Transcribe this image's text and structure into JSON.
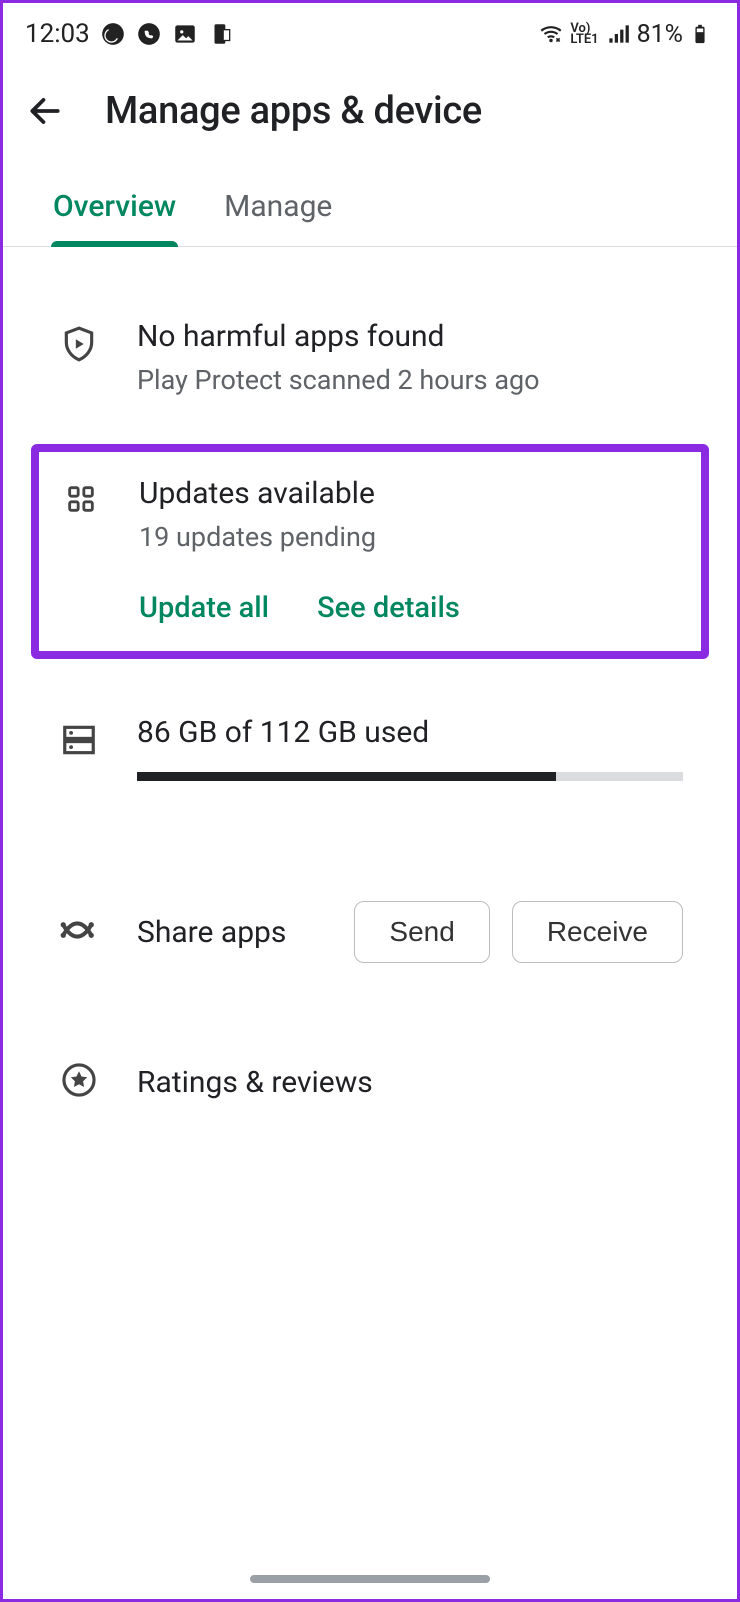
{
  "statusbar": {
    "time": "12:03",
    "lte_top": "Vo)",
    "lte_bottom": "LTE1",
    "battery_text": "81%"
  },
  "header": {
    "title": "Manage apps & device"
  },
  "tabs": {
    "overview": "Overview",
    "manage": "Manage"
  },
  "protect": {
    "title": "No harmful apps found",
    "subtitle": "Play Protect scanned 2 hours ago"
  },
  "updates": {
    "title": "Updates available",
    "subtitle": "19 updates pending",
    "update_all": "Update all",
    "see_details": "See details"
  },
  "storage": {
    "label": "86 GB of 112 GB used",
    "used": 86,
    "total": 112
  },
  "share": {
    "label": "Share apps",
    "send": "Send",
    "receive": "Receive"
  },
  "ratings": {
    "label": "Ratings & reviews"
  },
  "colors": {
    "accent": "#01875f",
    "highlight_box_border": "#8a2be2"
  }
}
